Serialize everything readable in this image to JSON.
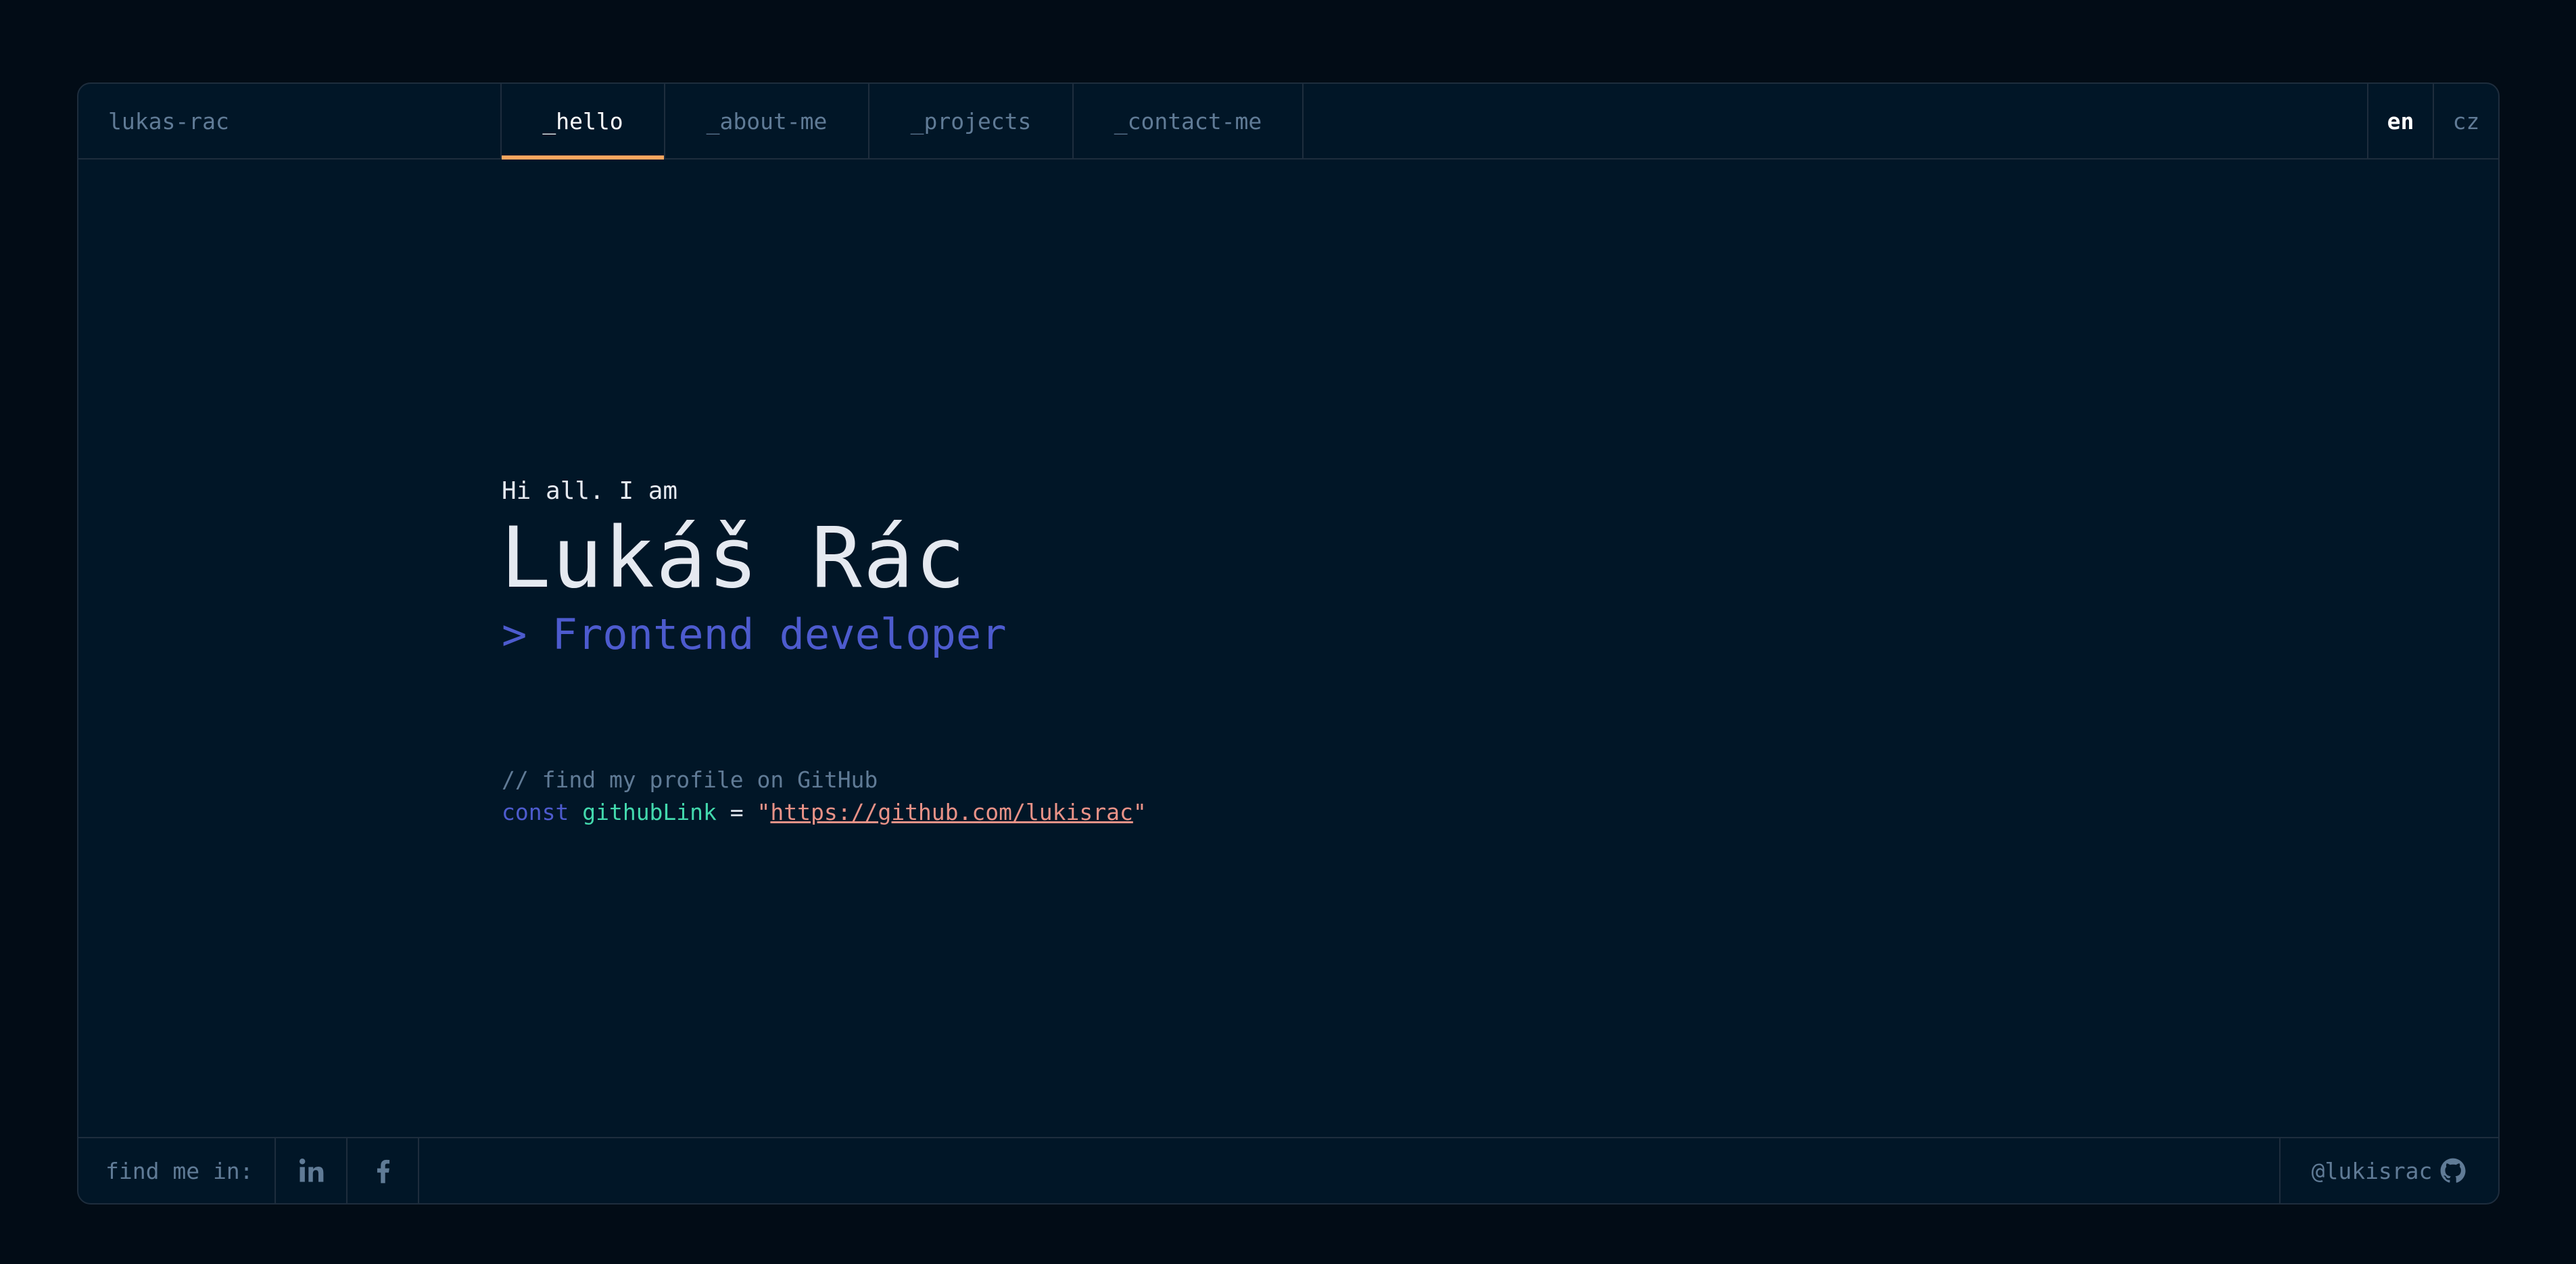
{
  "header": {
    "brand": "lukas-rac",
    "tabs": [
      {
        "label": "_hello",
        "active": true
      },
      {
        "label": "_about-me",
        "active": false
      },
      {
        "label": "_projects",
        "active": false
      },
      {
        "label": "_contact-me",
        "active": false
      }
    ],
    "languages": [
      {
        "label": "en",
        "active": true
      },
      {
        "label": "cz",
        "active": false
      }
    ]
  },
  "hero": {
    "greeting": "Hi all. I am",
    "name": "Lukáš Rác",
    "role": "> Frontend developer"
  },
  "snippet": {
    "comment": "// find my profile on GitHub",
    "keyword": "const",
    "variable": "githubLink",
    "operator": " = ",
    "quote_open": "\"",
    "url": "https://github.com/lukisrac",
    "quote_close": "\""
  },
  "footer": {
    "find_label": "find me in:",
    "socials": [
      {
        "icon": "linkedin-icon"
      },
      {
        "icon": "facebook-icon"
      }
    ],
    "github_handle": "@lukisrac",
    "github_icon": "github-icon"
  },
  "colors": {
    "background": "#011627",
    "accent_tab": "#fea55f",
    "keyword": "#4d5bce",
    "variable": "#43d9ad",
    "string": "#e99287",
    "muted": "#607b96"
  }
}
